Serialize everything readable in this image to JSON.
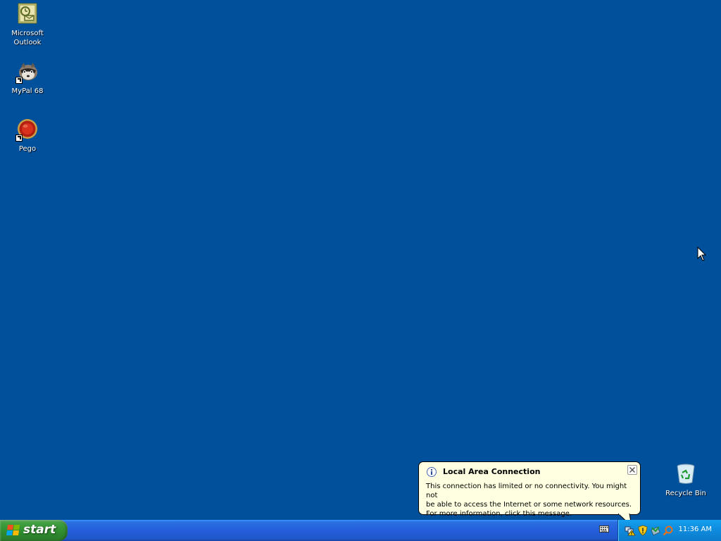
{
  "desktop": {
    "icons": [
      {
        "label": "Microsoft\nOutlook",
        "icon": "outlook-icon"
      },
      {
        "label": "MyPal 68",
        "icon": "mypal-icon"
      },
      {
        "label": "Pego",
        "icon": "pego-icon"
      },
      {
        "label": "Recycle Bin",
        "icon": "recycle-bin-icon"
      }
    ]
  },
  "balloon": {
    "title": "Local Area Connection",
    "body": "This connection has limited or no connectivity. You might not\nbe able to access the Internet or some network resources.\nFor more information, click this message.",
    "icon": "info-icon",
    "close_icon": "close-icon"
  },
  "taskbar": {
    "start_label": "start",
    "clock": "11:36 AM",
    "tray_icons": [
      "network-warning-icon",
      "security-shield-icon",
      "safely-remove-hardware-icon",
      "search-icon"
    ],
    "language_bar_icon": "keyboard-icon"
  },
  "colors": {
    "desktop_background": "#00509c",
    "taskbar": "#245edb",
    "start_button": "#3e9d3e",
    "balloon_background": "#ffffe1"
  }
}
